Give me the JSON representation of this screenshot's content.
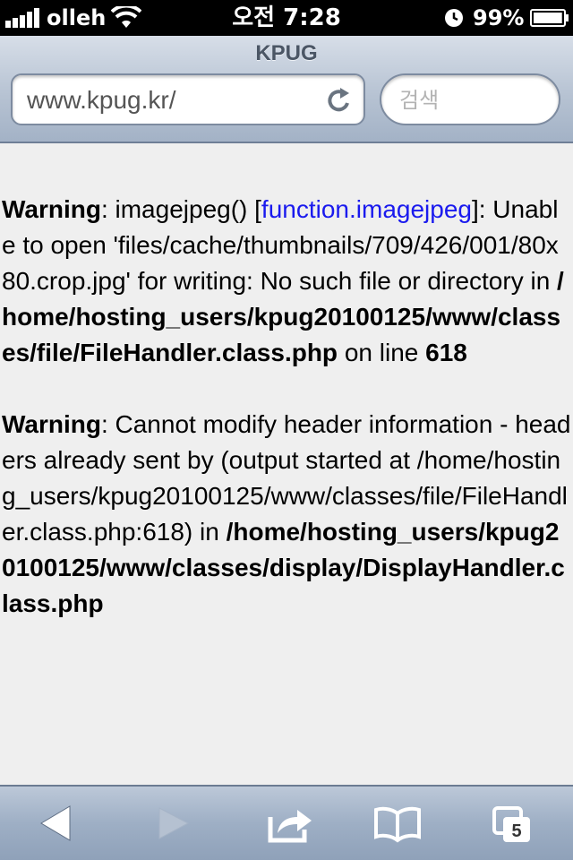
{
  "status": {
    "carrier": "olleh",
    "time": "오전 7:28",
    "battery_percent": "99%",
    "battery_level": 0.99,
    "signal_bars": 5
  },
  "browser": {
    "page_title": "KPUG",
    "url": "www.kpug.kr/",
    "search_placeholder": "검색",
    "tab_count": "5"
  },
  "warnings": [
    {
      "label": "Warning",
      "sep": ": ",
      "text1": "imagejpeg() [",
      "link": "function.imagejpeg",
      "text2": "]: Unable to open 'files/cache/thumbnails/709/426/001/80x80.crop.jpg' for writing: No such file or directory in ",
      "path": "/home/hosting_users/kpug20100125/www/classes/file/FileHandler.class.php",
      "text3": " on line ",
      "line": "618"
    },
    {
      "label": "Warning",
      "sep": ": ",
      "text1": "Cannot modify header information - headers already sent by (output started at /home/hosting_users/kpug20100125/www/classes/file/FileHandler.class.php:618) in ",
      "path": "/home/hosting_users/kpug20100125/www/classes/display/DisplayHandler.class.php"
    }
  ],
  "colors": {
    "link": "#1a1aee",
    "content_bg": "#efefef",
    "toolbar_icon": "#ffffff"
  },
  "icons": {
    "back": "back-arrow-icon",
    "forward": "forward-arrow-icon",
    "share": "share-icon",
    "bookmarks": "bookmarks-icon",
    "tabs": "tabs-icon",
    "reload": "reload-icon"
  }
}
